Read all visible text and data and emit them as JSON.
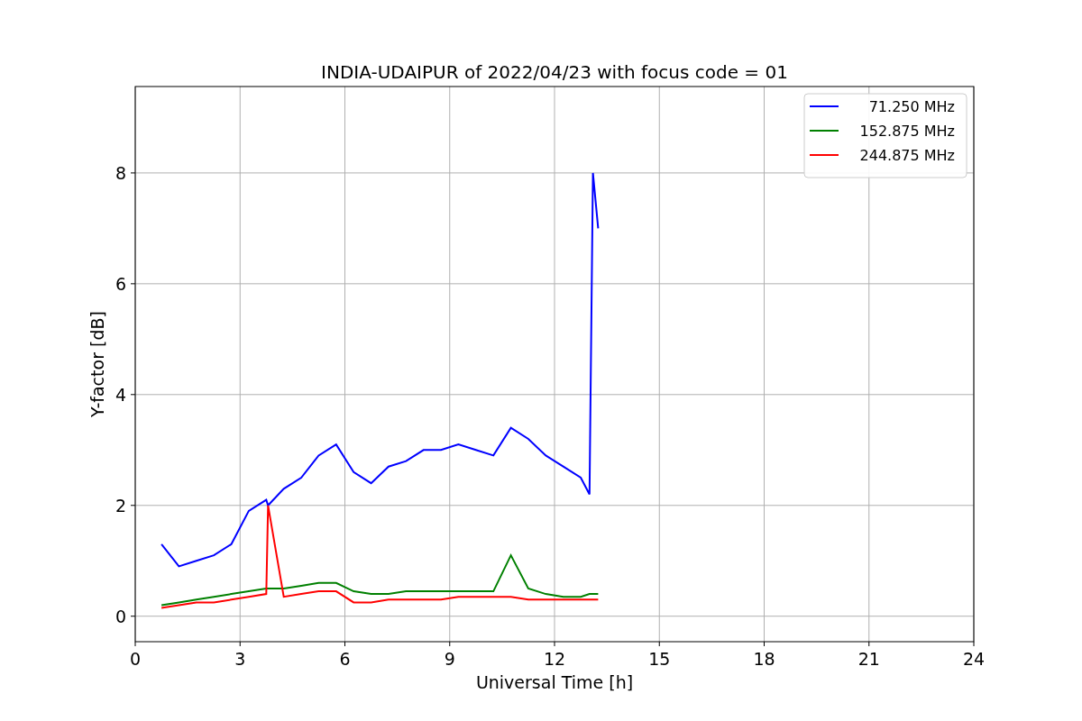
{
  "chart_data": {
    "type": "line",
    "title": "INDIA-UDAIPUR of 2022/04/23 with focus code = 01",
    "xlabel": "Universal Time [h]",
    "ylabel": "Y-factor [dB]",
    "x": [
      0.75,
      1.25,
      1.75,
      2.25,
      2.75,
      3.25,
      3.75,
      3.8,
      4.25,
      4.75,
      5.25,
      5.75,
      6.25,
      6.75,
      7.25,
      7.75,
      8.25,
      8.75,
      9.25,
      9.75,
      10.25,
      10.75,
      11.25,
      11.75,
      12.25,
      12.75,
      13.0,
      13.1,
      13.25
    ],
    "series": [
      {
        "name": "71.250 MHz",
        "color": "#0000ff",
        "values": [
          1.3,
          0.9,
          1.0,
          1.1,
          1.3,
          1.9,
          2.1,
          2.0,
          2.3,
          2.5,
          2.9,
          3.1,
          2.6,
          2.4,
          2.7,
          2.8,
          3.0,
          3.0,
          3.1,
          3.0,
          2.9,
          3.4,
          3.2,
          2.9,
          2.7,
          2.5,
          2.2,
          8.0,
          7.0
        ]
      },
      {
        "name": "152.875 MHz",
        "color": "#008000",
        "values": [
          0.2,
          0.25,
          0.3,
          0.35,
          0.4,
          0.45,
          0.5,
          0.5,
          0.5,
          0.55,
          0.6,
          0.6,
          0.45,
          0.4,
          0.4,
          0.45,
          0.45,
          0.45,
          0.45,
          0.45,
          0.45,
          1.1,
          0.5,
          0.4,
          0.35,
          0.35,
          0.4,
          0.4,
          0.4
        ]
      },
      {
        "name": "244.875 MHz",
        "color": "#ff0000",
        "values": [
          0.15,
          0.2,
          0.25,
          0.25,
          0.3,
          0.35,
          0.4,
          2.0,
          0.35,
          0.4,
          0.45,
          0.45,
          0.25,
          0.25,
          0.3,
          0.3,
          0.3,
          0.3,
          0.35,
          0.35,
          0.35,
          0.35,
          0.3,
          0.3,
          0.3,
          0.3,
          0.3,
          0.3,
          0.3
        ]
      }
    ],
    "xlim": [
      0,
      24
    ],
    "ylim": [
      -0.46,
      9.56
    ],
    "xticks": [
      0,
      3,
      6,
      9,
      12,
      15,
      18,
      21,
      24
    ],
    "yticks": [
      0,
      2,
      4,
      6,
      8
    ],
    "grid": true,
    "legend": true
  }
}
